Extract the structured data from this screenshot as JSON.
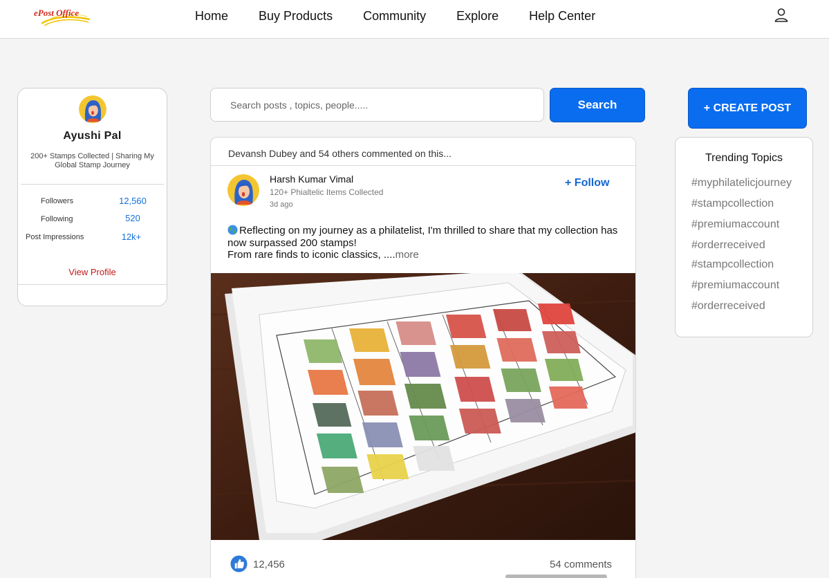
{
  "header": {
    "logo_text": "ePost Office",
    "nav": [
      "Home",
      "Buy Products",
      "Community",
      "Explore",
      "Help Center"
    ]
  },
  "profile": {
    "name": "Ayushi Pal",
    "bio": "200+ Stamps Collected | Sharing My Global Stamp Journey",
    "stats": [
      {
        "label": "Followers",
        "value": "12,560"
      },
      {
        "label": "Following",
        "value": "520"
      },
      {
        "label": "Post Impressions",
        "value": "12k+"
      }
    ],
    "view_profile": "View Profile"
  },
  "search": {
    "placeholder": "Search posts , topics, people.....",
    "button": "Search"
  },
  "post": {
    "activity": "Devansh Dubey and 54 others commented on this...",
    "author": "Harsh Kumar Vimal",
    "author_subtitle": "120+ Phialtelic Items Collected",
    "time": "3d ago",
    "follow": "+ Follow",
    "text_line1": "Reflecting on my journey as a philatelist, I'm thrilled to share that my collection has now surpassed 200 stamps!",
    "text_line2": "From rare finds to iconic classics, ....",
    "more": "more",
    "likes": "12,456",
    "comments": "54 comments"
  },
  "create_post": "+ CREATE POST",
  "trending": {
    "title": "Trending Topics",
    "topics": [
      "#myphilatelicjourney",
      "#stampcollection",
      "#premiumaccount",
      "#orderreceived",
      "#stampcollection",
      "#premiumaccount",
      "#orderreceived"
    ]
  },
  "colors": {
    "primary": "#0a6df0",
    "link_blue": "#1570d8",
    "view_profile_red": "#c21818",
    "background": "#f4f4f4"
  },
  "icons": [
    "epost-logo-icon",
    "user-icon",
    "globe-icon",
    "like-icon"
  ]
}
